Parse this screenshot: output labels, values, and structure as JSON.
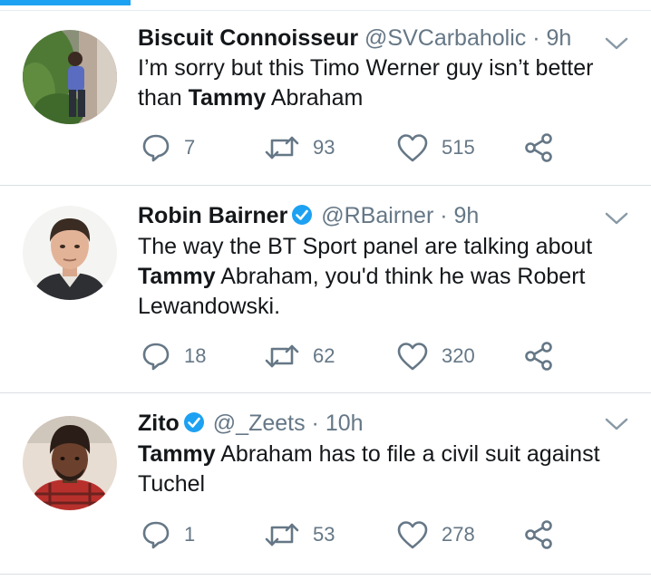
{
  "tweets": [
    {
      "name": "Biscuit Connoisseur",
      "verified": false,
      "handle": "@SVCarbaholic",
      "time": "9h",
      "text_lines": [
        [
          "I’m sorry but this Timo Werner guy isn’t better"
        ],
        [
          "than ",
          "Tammy",
          " Abraham"
        ]
      ],
      "replies": "7",
      "retweets": "93",
      "likes": "515"
    },
    {
      "name": "Robin Bairner",
      "verified": true,
      "handle": "@RBairner",
      "time": "9h",
      "text_lines": [
        [
          "The way the BT Sport panel are talking about"
        ],
        [
          "",
          "Tammy",
          " Abraham, you'd think he was Robert"
        ],
        [
          "Lewandowski."
        ]
      ],
      "replies": "18",
      "retweets": "62",
      "likes": "320"
    },
    {
      "name": "Zito",
      "verified": true,
      "handle": "@_Zeets",
      "time": "10h",
      "text_lines": [
        [
          "",
          "Tammy",
          " Abraham has to file a civil suit against"
        ],
        [
          "Tuchel"
        ]
      ],
      "replies": "1",
      "retweets": "53",
      "likes": "278"
    }
  ],
  "separator": "·",
  "colors": {
    "accent": "#1da1f2",
    "text": "#14171a",
    "muted": "#657786"
  },
  "icons": {
    "reply": "reply-icon",
    "retweet": "retweet-icon",
    "like": "heart-icon",
    "share": "share-icon",
    "menu": "chevron-down-icon",
    "verified": "verified-badge-icon"
  }
}
